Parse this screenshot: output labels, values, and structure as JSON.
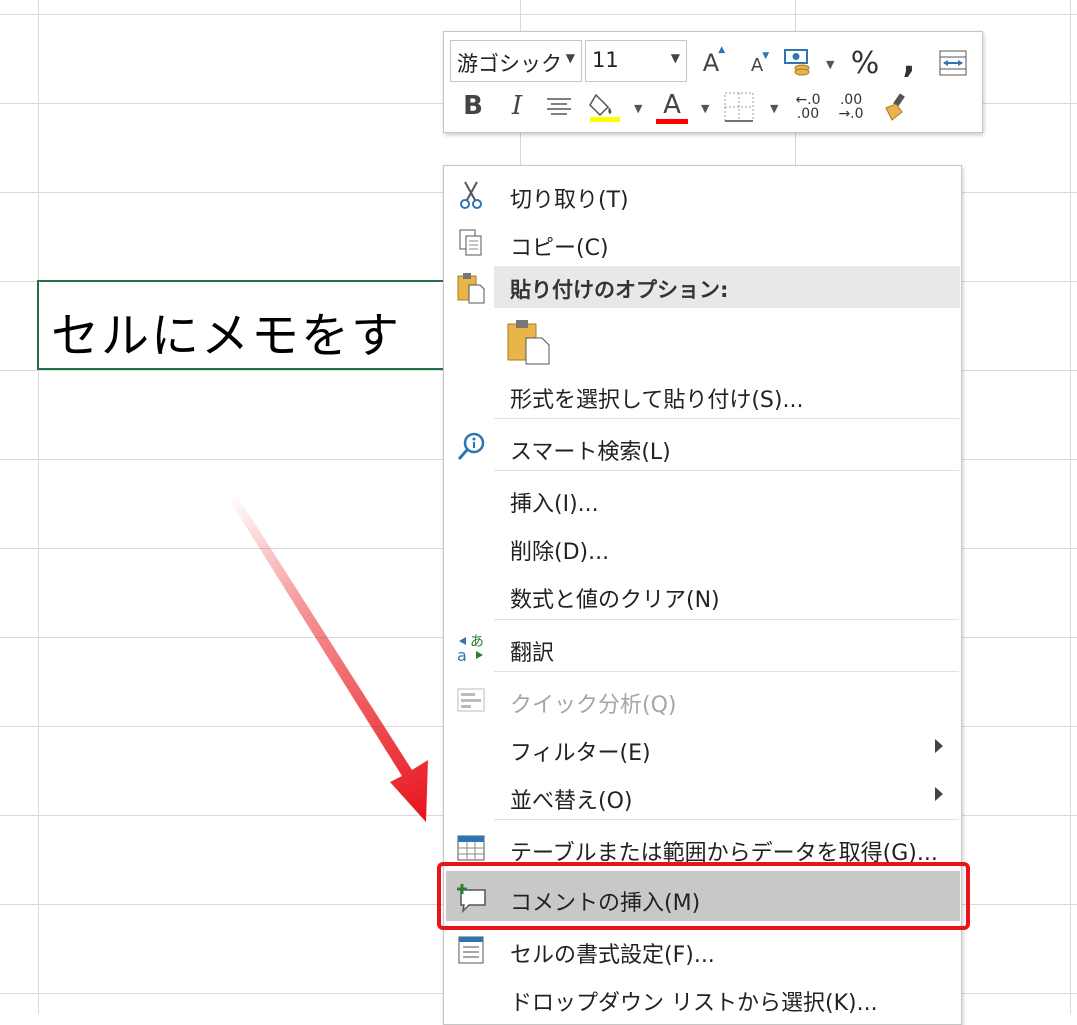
{
  "cell": {
    "text": "セルにメモをす"
  },
  "mini_toolbar": {
    "font_name": "游ゴシック",
    "font_size": "11",
    "increase_font": "A",
    "decrease_font": "A",
    "percent": "%",
    "comma": ",",
    "bold": "B",
    "italic": "I",
    "font_color_letter": "A",
    "inc_decimal_top": "←.0",
    "inc_decimal_bottom": ".00",
    "dec_decimal_top": ".00",
    "dec_decimal_bottom": "→.0",
    "fill_color": "#ffff00",
    "font_color": "#ff0000"
  },
  "context_menu": {
    "cut": "切り取り(T)",
    "copy": "コピー(C)",
    "paste_options": "貼り付けのオプション:",
    "paste_special": "形式を選択して貼り付け(S)...",
    "smart_lookup": "スマート検索(L)",
    "insert": "挿入(I)...",
    "delete": "削除(D)...",
    "clear_contents": "数式と値のクリア(N)",
    "translate": "翻訳",
    "quick_analysis": "クイック分析(Q)",
    "filter": "フィルター(E)",
    "sort": "並べ替え(O)",
    "get_data": "テーブルまたは範囲からデータを取得(G)...",
    "insert_comment": "コメントの挿入(M)",
    "format_cells": "セルの書式設定(F)...",
    "dropdown_pick": "ドロップダウン リストから選択(K)..."
  },
  "colors": {
    "highlight_border": "#e8141b",
    "arrow": "#e8141b",
    "cell_border": "#217346"
  }
}
